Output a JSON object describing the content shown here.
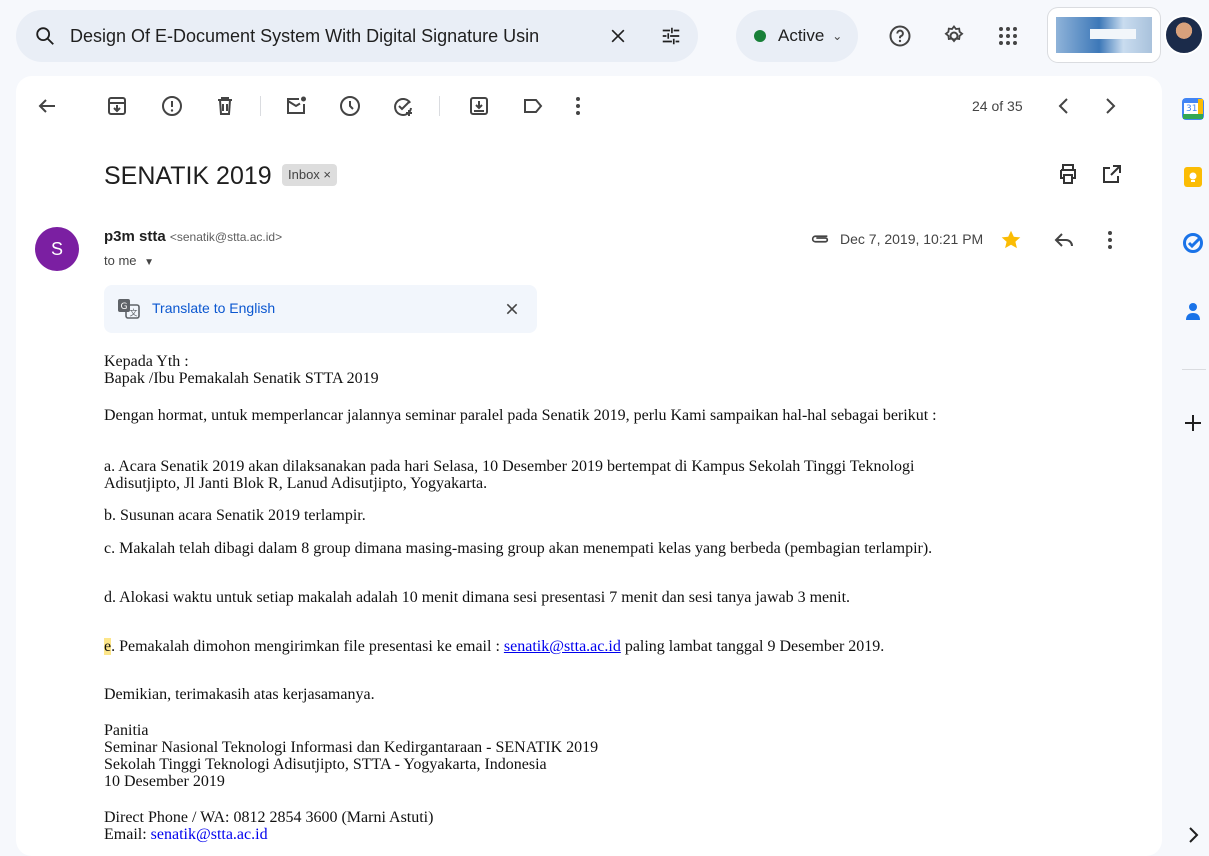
{
  "search": {
    "query": "Design Of E-Document System With Digital Signature Usin"
  },
  "status": {
    "label": "Active"
  },
  "toolbar": {
    "counter": "24 of 35"
  },
  "email": {
    "subject": "SENATIK 2019",
    "label_chip": "Inbox ×",
    "sender_name": "p3m stta",
    "sender_email": "<senatik@stta.ac.id>",
    "recipient": "to me",
    "date": "Dec 7, 2019, 10:21 PM",
    "avatar_letter": "S",
    "translate_label": "Translate to English",
    "body": {
      "greeting1": "Kepada Yth :",
      "greeting2": "Bapak /Ibu Pemakalah Senatik STTA 2019",
      "intro": "Dengan hormat, untuk memperlancar jalannya seminar paralel pada Senatik 2019, perlu Kami sampaikan hal-hal sebagai berikut :",
      "a1": "a.  Acara Senatik 2019 akan dilaksanakan pada hari Selasa, 10 Desember 2019 bertempat di Kampus Sekolah Tinggi Teknologi",
      "a2": "Adisutjipto, Jl Janti Blok R, Lanud Adisutjipto, Yogyakarta.",
      "b": "b. Susunan acara Senatik 2019 terlampir.",
      "c": "c. Makalah telah dibagi dalam 8 group dimana masing-masing group akan menempati kelas yang berbeda (pembagian terlampir).",
      "d": "d.   Alokasi waktu untuk setiap makalah adalah 10 menit dimana sesi presentasi 7 menit dan sesi tanya jawab 3 menit.",
      "e_letter": "e",
      "e_text1": ".   Pemakalah dimohon mengirimkan file presentasi ke email  : ",
      "e_link": "senatik@stta.ac.id",
      "e_text2": " paling lambat tanggal 9 Desember 2019.",
      "closing": "Demikian, terimakasih atas kerjasamanya.",
      "sig1": "Panitia",
      "sig2": "Seminar Nasional Teknologi Informasi dan Kedirgantaraan - SENATIK 2019",
      "sig3": "Sekolah Tinggi Teknologi Adisutjipto, STTA - Yogyakarta, Indonesia",
      "sig4": "10 Desember 2019",
      "phone": "Direct Phone / WA: 0812 2854 3600 (Marni Astuti)",
      "email_label": "Email: ",
      "email_link": "senatik@stta.ac.id"
    }
  },
  "side_rail": {
    "calendar_day": "31"
  },
  "colors": {
    "active_dot": "#188038",
    "link": "#0b57d0",
    "avatar": "#7b1fa2",
    "star": "#fbbc04"
  }
}
